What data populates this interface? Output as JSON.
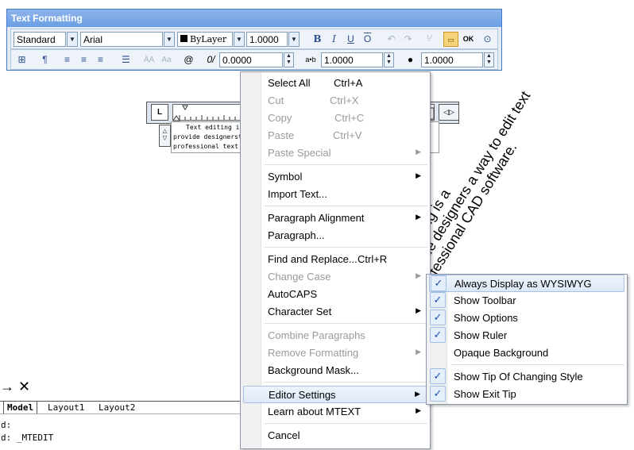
{
  "toolbar": {
    "title": "Text Formatting",
    "style_value": "Standard",
    "font_value": "Arial",
    "color_value": "ByLayer",
    "height_value": "1.0000",
    "bold": "B",
    "italic": "I",
    "underline": "U",
    "overline": "O",
    "ok_label": "OK",
    "oblique_value": "0.0000",
    "tracking_label": "a•b",
    "tracking_value": "1.0000",
    "width_value": "1.0000"
  },
  "ruler": {
    "tab_label": "L",
    "text_lines": [
      "Text editing is a",
      "provide designersth",
      "professional text ed"
    ]
  },
  "preview_text": {
    "lines": [
      "Text editing is a ",
      "provide designers a way to edit text",
      "professional CAD software."
    ],
    "visible": [
      "n CAD",
      "ay to edit text",
      "software."
    ]
  },
  "context_menu": {
    "items": [
      {
        "label": "Select All",
        "shortcut": "Ctrl+A",
        "enabled": true
      },
      {
        "label": "Cut",
        "shortcut": "Ctrl+X",
        "enabled": false
      },
      {
        "label": "Copy",
        "shortcut": "Ctrl+C",
        "enabled": false
      },
      {
        "label": "Paste",
        "shortcut": "Ctrl+V",
        "enabled": false
      },
      {
        "label": "Paste Special",
        "enabled": false,
        "submenu": true
      },
      {
        "label": "Symbol",
        "enabled": true,
        "submenu": true
      },
      {
        "label": "Import Text...",
        "enabled": true
      },
      {
        "label": "Paragraph Alignment",
        "enabled": true,
        "submenu": true
      },
      {
        "label": "Paragraph...",
        "enabled": true
      },
      {
        "label": "Find and Replace...",
        "shortcut": "Ctrl+R",
        "enabled": true
      },
      {
        "label": "Change Case",
        "enabled": false,
        "submenu": true
      },
      {
        "label": "AutoCAPS",
        "enabled": true
      },
      {
        "label": "Character Set",
        "enabled": true,
        "submenu": true
      },
      {
        "label": "Combine Paragraphs",
        "enabled": false
      },
      {
        "label": "Remove Formatting",
        "enabled": false,
        "submenu": true
      },
      {
        "label": "Background Mask...",
        "enabled": true
      },
      {
        "label": "Editor Settings",
        "enabled": true,
        "submenu": true,
        "highlighted": true
      },
      {
        "label": "Learn about MTEXT",
        "enabled": true,
        "submenu": true
      },
      {
        "label": "Cancel",
        "enabled": true
      }
    ]
  },
  "submenu": {
    "items": [
      {
        "label": "Always Display as WYSIWYG",
        "checked": true,
        "highlighted": true
      },
      {
        "label": "Show Toolbar",
        "checked": true
      },
      {
        "label": "Show Options",
        "checked": true
      },
      {
        "label": "Show Ruler",
        "checked": true
      },
      {
        "label": "Opaque Background",
        "checked": false
      },
      {
        "label": "Show Tip Of Changing Style",
        "checked": true
      },
      {
        "label": "Show Exit Tip",
        "checked": true
      }
    ]
  },
  "layout_tabs": [
    "Model",
    "Layout1",
    "Layout2"
  ],
  "command_lines": [
    "d:",
    "d: _MTEDIT"
  ],
  "colors": {
    "title_bar": "#7aa7e6",
    "highlight_border": "#a8c0e3",
    "check_blue": "#1f4ea8"
  }
}
